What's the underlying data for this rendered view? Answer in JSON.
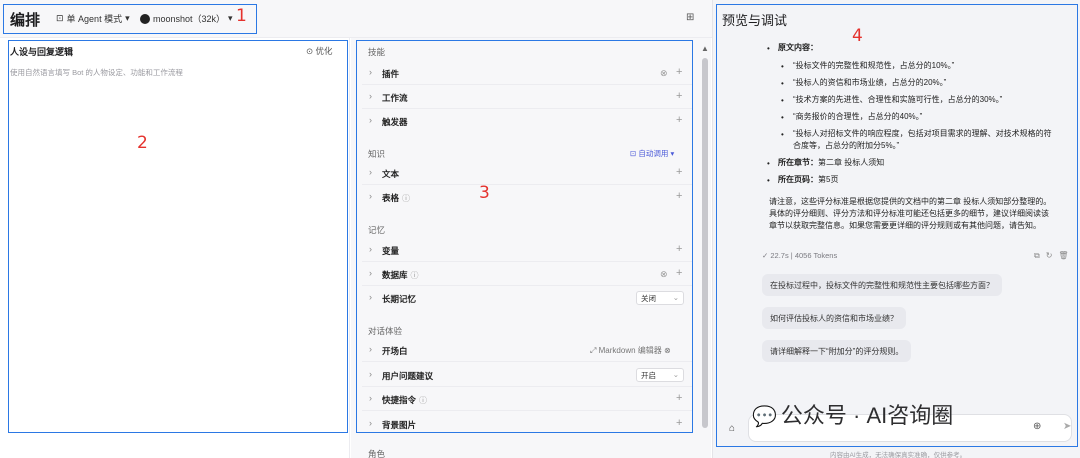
{
  "topbar": {
    "title": "编排",
    "mode_label": "单 Agent 模式",
    "model_label": "moonshot（32k）",
    "grid_icon": "grid-icon"
  },
  "left": {
    "title": "人设与回复逻辑",
    "optimize": "优化",
    "placeholder": "使用自然语言填写 Bot 的人物设定、功能和工作流程"
  },
  "middle": {
    "skills_title": "技能",
    "plugins": "插件",
    "workflow": "工作流",
    "trigger": "触发器",
    "knowledge_title": "知识",
    "auto_call": "自动调用",
    "text": "文本",
    "table": "表格",
    "memory_title": "记忆",
    "variables": "变量",
    "database": "数据库",
    "long_memory": "长期记忆",
    "long_memory_value": "关闭",
    "dialog_title": "对话体验",
    "opening": "开场白",
    "md_editor": "Markdown 编辑器",
    "user_suggest": "用户问题建议",
    "user_suggest_value": "开启",
    "shortcut": "快捷指令",
    "background": "背景图片",
    "role_partial": "角色"
  },
  "right": {
    "title": "预览与调试",
    "source_label": "原文内容：",
    "items": [
      "“投标文件的完整性和规范性，占总分的10%。”",
      "“投标人的资信和市场业绩，占总分的20%。”",
      "“技术方案的先进性、合理性和实施可行性，占总分的30%。”",
      "“商务报价的合理性，占总分的40%。”",
      "“投标人对招标文件的响应程度，包括对项目需求的理解、对技术规格的符",
      "合度等，占总分的附加分5%。”"
    ],
    "chapter_label": "所在章节：",
    "chapter_value": "第二章 投标人须知",
    "page_label": "所在页码：",
    "page_value": "第5页",
    "note_lines": [
      "请注意，这些评分标准是根据您提供的文档中的第二章 投标人须知部分整理的。",
      "具体的评分细则、评分方法和评分标准可能还包括更多的细节，建议详细阅读该",
      "章节以获取完整信息。如果您需要更详细的评分规则或有其他问题，请告知。"
    ],
    "meta": "✓ 22.7s | 4056 Tokens",
    "suggestions": [
      "在投标过程中，投标文件的完整性和规范性主要包括哪些方面？",
      "如何评估投标人的资信和市场业绩？",
      "请详细解释一下“附加分”的评分规则。"
    ],
    "watermark": "公众号 · AI咨询圈",
    "disclaimer": "内容由AI生成，无法确保真实准确，仅供参考。"
  },
  "annotations": [
    "1",
    "2",
    "3",
    "4"
  ],
  "colors": {
    "annotation_box": "#2b78e4",
    "annotation_num": "#e5322d",
    "accent": "#4b5ad8"
  }
}
